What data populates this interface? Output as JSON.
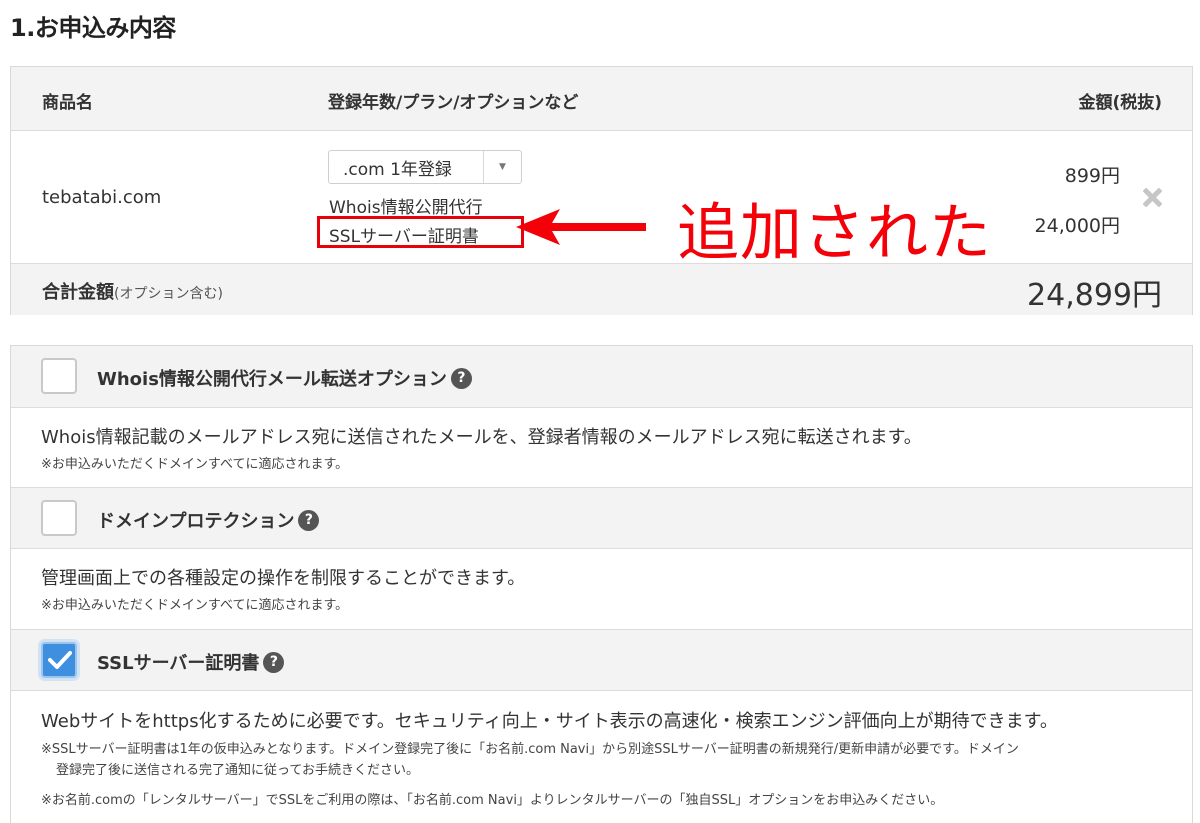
{
  "section_title": "1.お申込み内容",
  "order": {
    "headers": {
      "product": "商品名",
      "plan": "登録年数/プラン/オプションなど",
      "price": "金額(税抜)"
    },
    "domain": "tebatabi.com",
    "plan_select_value": ".com 1年登録",
    "options": [
      {
        "label": "Whois情報公開代行",
        "price": "899円"
      },
      {
        "label": "SSLサーバー証明書",
        "price": "24,000円"
      }
    ],
    "total_label": "合計金額",
    "total_sub": "(オプション含む)",
    "total_amount": "24,899円"
  },
  "annotation": {
    "text": "追加された",
    "color": "#f40008"
  },
  "option_list": [
    {
      "title": "Whois情報公開代行メール転送オプション",
      "checked": false,
      "description": "Whois情報記載のメールアドレス宛に送信されたメールを、登録者情報のメールアドレス宛に転送されます。",
      "notes": [
        "※お申込みいただくドメインすべてに適応されます。"
      ]
    },
    {
      "title": "ドメインプロテクション",
      "checked": false,
      "description": "管理画面上での各種設定の操作を制限することができます。",
      "notes": [
        "※お申込みいただくドメインすべてに適応されます。"
      ]
    },
    {
      "title": "SSLサーバー証明書",
      "checked": true,
      "description": "Webサイトをhttps化するために必要です。セキュリティ向上・サイト表示の高速化・検索エンジン評価向上が期待できます。",
      "notes": [
        "※SSLサーバー証明書は1年の仮申込みとなります。ドメイン登録完了後に「お名前.com Navi」から別途SSLサーバー証明書の新規発行/更新申請が必要です。ドメイン",
        "登録完了後に送信される完了通知に従ってお手続きください。",
        "※お名前.comの「レンタルサーバー」でSSLをご利用の際は、「お名前.com Navi」よりレンタルサーバーの「独自SSL」オプションをお申込みください。"
      ]
    }
  ],
  "help_glyph": "?",
  "colors": {
    "accent_blue": "#3f8fe0",
    "highlight_red": "#e8000a",
    "header_bg": "#f3f3f3"
  },
  "icons": [
    "chevron-down-icon",
    "close-icon",
    "help-icon",
    "checkmark-icon",
    "arrow-left-icon"
  ]
}
